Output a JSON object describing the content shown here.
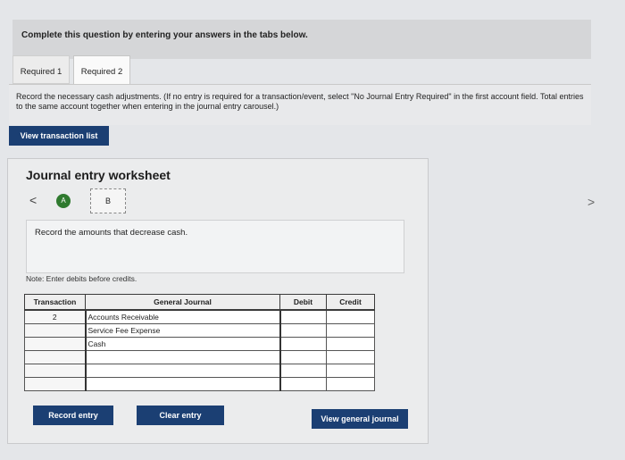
{
  "instruction": "Complete this question by entering your answers in the tabs below.",
  "tabs": [
    {
      "label": "Required 1"
    },
    {
      "label": "Required 2"
    }
  ],
  "instructions_text": "Record the necessary cash adjustments. (If no entry is required for a transaction/event, select \"No Journal Entry Required\" in the first account field. Total entries to the same account together when entering in the journal entry carousel.)",
  "view_transaction_label": "View transaction list",
  "worksheet": {
    "title": "Journal entry worksheet",
    "nav_prev": "<",
    "nav_next": ">",
    "entries": [
      "A",
      "B"
    ],
    "description": "Record the amounts that decrease cash.",
    "note": "Note: Enter debits before credits."
  },
  "table": {
    "headers": {
      "transaction": "Transaction",
      "journal": "General Journal",
      "debit": "Debit",
      "credit": "Credit"
    },
    "rows": [
      {
        "transaction": "2",
        "account": "Accounts Receivable",
        "debit": "",
        "credit": ""
      },
      {
        "transaction": "",
        "account": "Service Fee Expense",
        "debit": "",
        "credit": ""
      },
      {
        "transaction": "",
        "account": "Cash",
        "debit": "",
        "credit": ""
      },
      {
        "transaction": "",
        "account": "",
        "debit": "",
        "credit": ""
      },
      {
        "transaction": "",
        "account": "",
        "debit": "",
        "credit": ""
      },
      {
        "transaction": "",
        "account": "",
        "debit": "",
        "credit": ""
      }
    ]
  },
  "buttons": {
    "record": "Record entry",
    "clear": "Clear entry",
    "view_general": "View general journal"
  },
  "colors": {
    "button_bg": "#1b3f73",
    "active_entry": "#2f7a2f"
  }
}
